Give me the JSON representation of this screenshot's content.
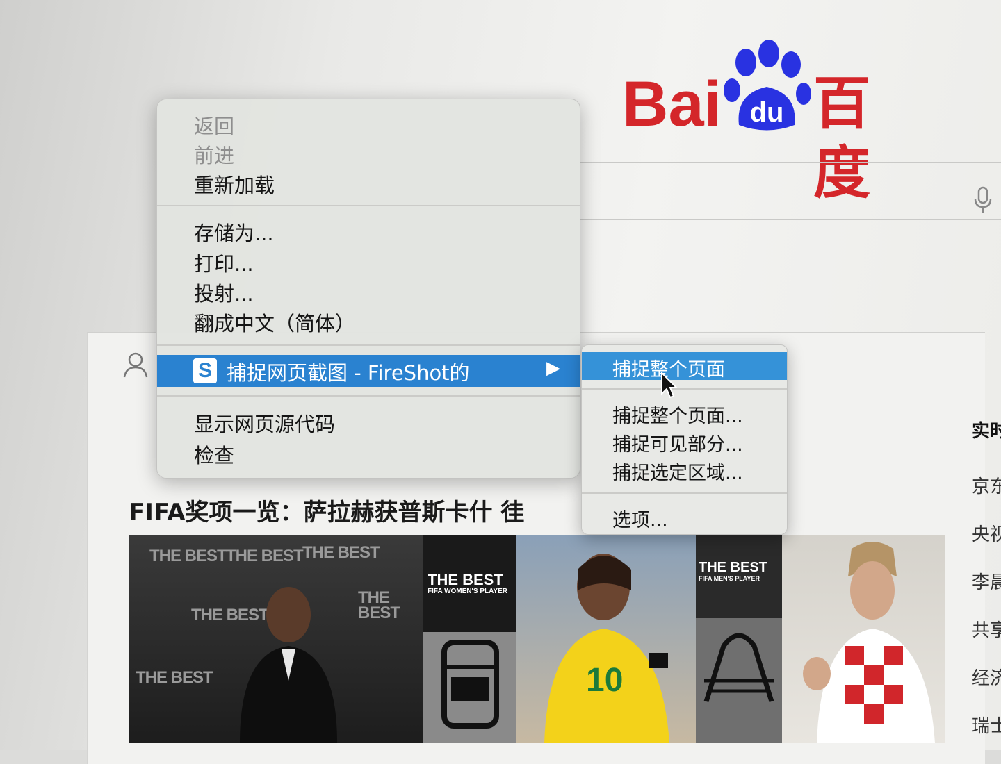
{
  "logo": {
    "text_latin": "Bai",
    "text_paw": "du",
    "text_cn": "百度"
  },
  "colors": {
    "baidu_red": "#d4262a",
    "baidu_blue": "#2932e1",
    "highlight": "#2a82d0"
  },
  "main": {
    "news_title": "FIFA奖项一览：萨拉赫获普斯卡什 徍",
    "side_list": [
      "实时",
      "京东",
      "央视",
      "李晨",
      "共享",
      "经济",
      "瑞士"
    ]
  },
  "photos": {
    "watermark": "THE BEST",
    "womens_label": "THE BEST",
    "womens_sub": "FIFA WOMEN'S PLAYER",
    "mens_label": "THE BEST",
    "mens_sub": "FIFA MEN'S PLAYER",
    "jersey_number": "10"
  },
  "context_menu": {
    "back": "返回",
    "forward": "前进",
    "reload": "重新加载",
    "save_as": "存储为...",
    "print": "打印...",
    "cast": "投射...",
    "translate": "翻成中文（简体）",
    "fireshot": "捕捉网页截图 - FireShot的",
    "fireshot_icon": "S",
    "submenu_arrow": "▶",
    "view_source": "显示网页源代码",
    "inspect": "检查"
  },
  "submenu": {
    "capture_entire": "捕捉整个页面",
    "capture_entire_dialog": "捕捉整个页面...",
    "capture_visible": "捕捉可见部分...",
    "capture_selection": "捕捉选定区域...",
    "options": "选项..."
  }
}
